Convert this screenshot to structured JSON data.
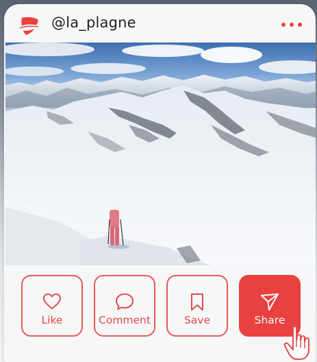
{
  "post": {
    "username": "@la_plagne",
    "photo_description": "snowy-mountain-skier-photo"
  },
  "actions": {
    "like_label": "Like",
    "comment_label": "Comment",
    "save_label": "Save",
    "share_label": "Share"
  },
  "icons": {
    "avatar": "brand-logo-icon",
    "more": "more-dots-icon",
    "like": "heart-icon",
    "comment": "comment-bubble-icon",
    "save": "bookmark-icon",
    "share": "send-icon",
    "cursor": "hand-pointer-icon"
  },
  "colors": {
    "accent": "#e8413f",
    "card_background": "#f7f7f7",
    "text": "#1f1f1f"
  }
}
